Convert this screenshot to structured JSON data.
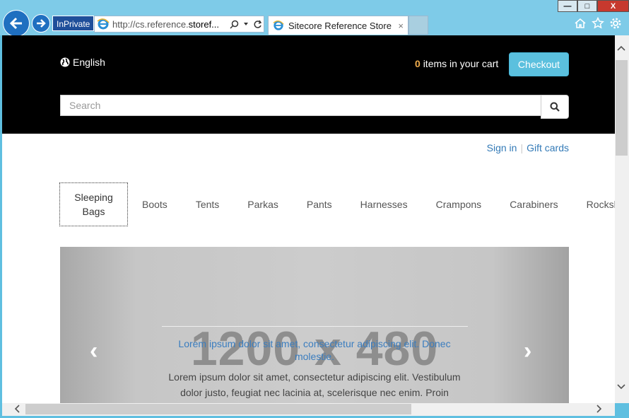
{
  "browser": {
    "inprivate_label": "InPrivate",
    "url_prefix": "http://cs.reference.",
    "url_host": "storef...",
    "tab_title": "Sitecore Reference Store",
    "tab_close": "×",
    "minimize": "—",
    "maximize": "□",
    "close": "X"
  },
  "header": {
    "language": "English",
    "cart_count": "0",
    "cart_text": "items in your cart",
    "checkout_label": "Checkout",
    "search_placeholder": "Search"
  },
  "toplinks": {
    "sign_in": "Sign in",
    "separator": "|",
    "gift_cards": "Gift cards"
  },
  "categories": [
    {
      "label": "Sleeping Bags",
      "active": true
    },
    {
      "label": "Boots"
    },
    {
      "label": "Tents"
    },
    {
      "label": "Parkas"
    },
    {
      "label": "Pants"
    },
    {
      "label": "Harnesses"
    },
    {
      "label": "Crampons"
    },
    {
      "label": "Carabiners"
    },
    {
      "label": "Rockshoes"
    }
  ],
  "carousel": {
    "placeholder": "1200 x 480",
    "caption_title": "Lorem ipsum dolor sit amet, consectetur adipiscing elit. Donec molestie.",
    "caption_text": "Lorem ipsum dolor sit amet, consectetur adipiscing elit. Vestibulum dolor justo, feugiat nec lacinia at, scelerisque nec enim. Proin",
    "prev_arrow": "‹",
    "next_arrow": "›"
  },
  "colors": {
    "header_bg": "#000000",
    "accent": "#5bc0de",
    "link": "#337ab7",
    "cart_count": "#f0ad4e"
  }
}
